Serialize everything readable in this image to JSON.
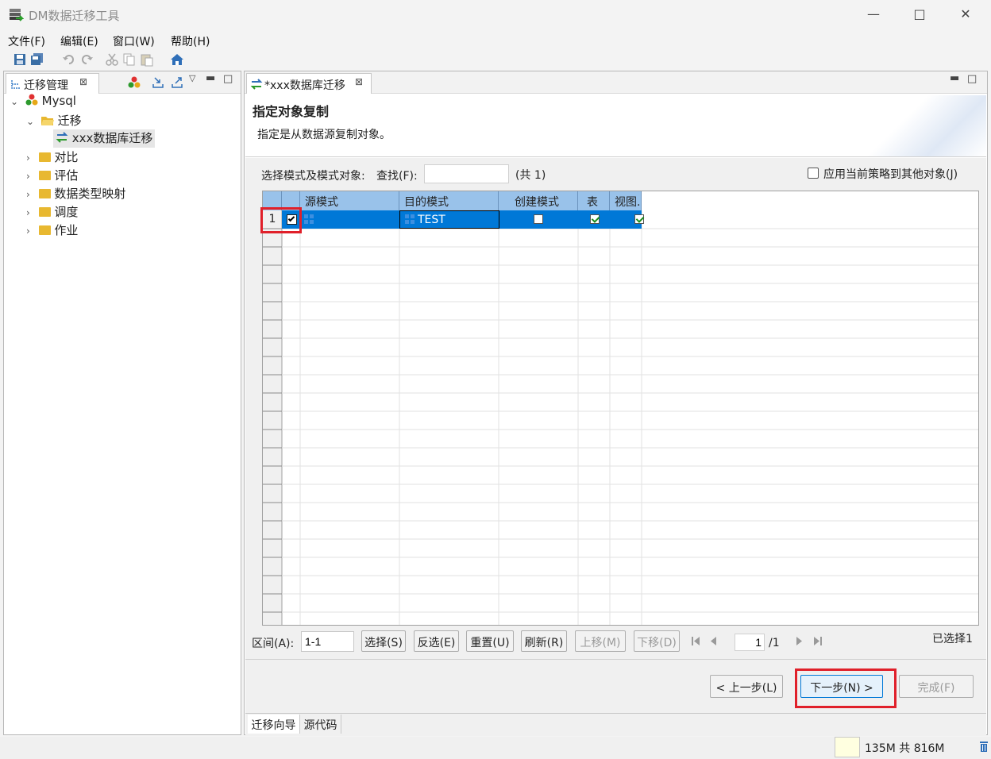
{
  "window": {
    "title": "DM数据迁移工具"
  },
  "menu": [
    "文件(F)",
    "编辑(E)",
    "窗口(W)",
    "帮助(H)"
  ],
  "left_panel": {
    "tab_title": "迁移管理",
    "tree": {
      "root": "Mysql",
      "migration": "迁移",
      "migration_item": "xxx数据库迁移",
      "folders": [
        "对比",
        "评估",
        "数据类型映射",
        "调度",
        "作业"
      ]
    }
  },
  "editor": {
    "tab_title": "*xxx数据库迁移",
    "wizard_title": "指定对象复制",
    "wizard_desc": "指定是从数据源复制对象。",
    "select_label": "选择模式及模式对象:",
    "find_label": "查找(F):",
    "find_value": "",
    "count_text": "(共 1)",
    "apply_policy_label": "应用当前策略到其他对象(J)",
    "apply_policy_checked": false,
    "columns": [
      "源模式",
      "目的模式",
      "创建模式",
      "表",
      "视图."
    ],
    "rows": [
      {
        "num": "1",
        "selected": true,
        "source_schema": "",
        "target_schema": "TEST",
        "create_schema": false,
        "tables": true,
        "views": true
      }
    ],
    "range_label": "区间(A):",
    "range_value": "1-1",
    "buttons": {
      "select": "选择(S)",
      "invert": "反选(E)",
      "reset": "重置(U)",
      "refresh": "刷新(R)",
      "move_up": "上移(M)",
      "move_down": "下移(D)"
    },
    "page": {
      "current": "1",
      "total": "/1"
    },
    "selected_text": "已选择1",
    "nav": {
      "prev": "< 上一步(L)",
      "next": "下一步(N) >",
      "finish": "完成(F)"
    },
    "bottom_tabs": [
      "迁移向导",
      "源代码"
    ]
  },
  "status": {
    "memory": "135M 共 816M"
  },
  "colors": {
    "selection": "#0078d7",
    "header": "#99c2ea",
    "highlight": "#e0202a"
  }
}
